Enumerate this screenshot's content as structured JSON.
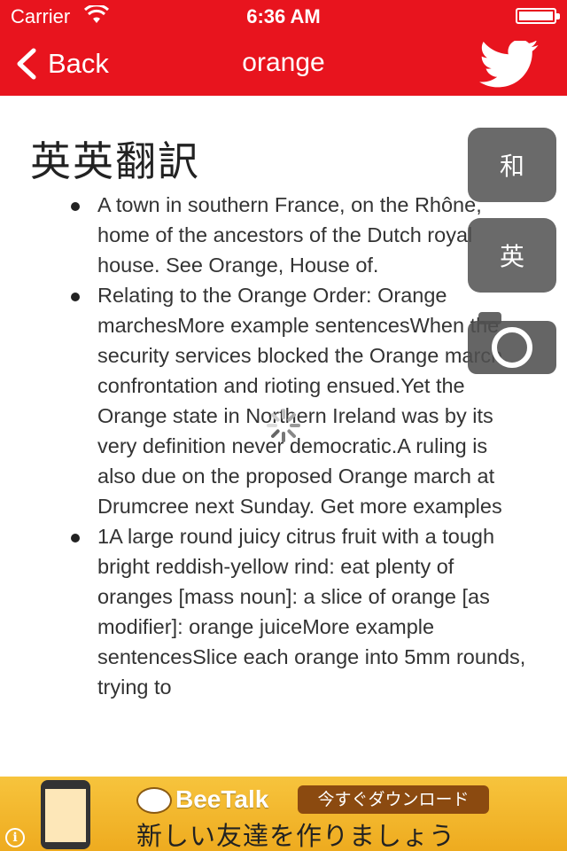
{
  "status_bar": {
    "carrier": "Carrier",
    "time": "6:36 AM"
  },
  "nav": {
    "back_label": "Back",
    "title": "orange",
    "share_icon": "twitter-bird-icon"
  },
  "content": {
    "heading": "英英翻訳",
    "definitions": [
      "A town in southern France, on the Rhône, home of the ancestors of the Dutch royal house. See Orange, House of.",
      "Relating to the Orange Order: Orange marchesMore example sentencesWhen the security services blocked the Orange march, confrontation and rioting ensued.Yet the Orange state in Northern Ireland was by its very definition never democratic.A ruling is also due on the proposed Orange march at Drumcree next Sunday. Get more examples",
      "1A large round juicy citrus fruit with a tough bright reddish-yellow rind: eat plenty of oranges [mass noun]: a slice of orange [as modifier]: orange juiceMore example sentencesSlice each orange into 5mm rounds, trying to"
    ]
  },
  "side_buttons": {
    "japanese": "和",
    "english": "英",
    "camera_icon": "camera-icon"
  },
  "ad": {
    "brand": "BeeTalk",
    "cta": "今すぐダウンロード",
    "tagline": "新しい友達を作りましょう",
    "info_glyph": "i"
  },
  "colors": {
    "nav_red": "#e8141e",
    "side_button_gray": "#505050",
    "ad_yellow": "#f7c43d"
  }
}
